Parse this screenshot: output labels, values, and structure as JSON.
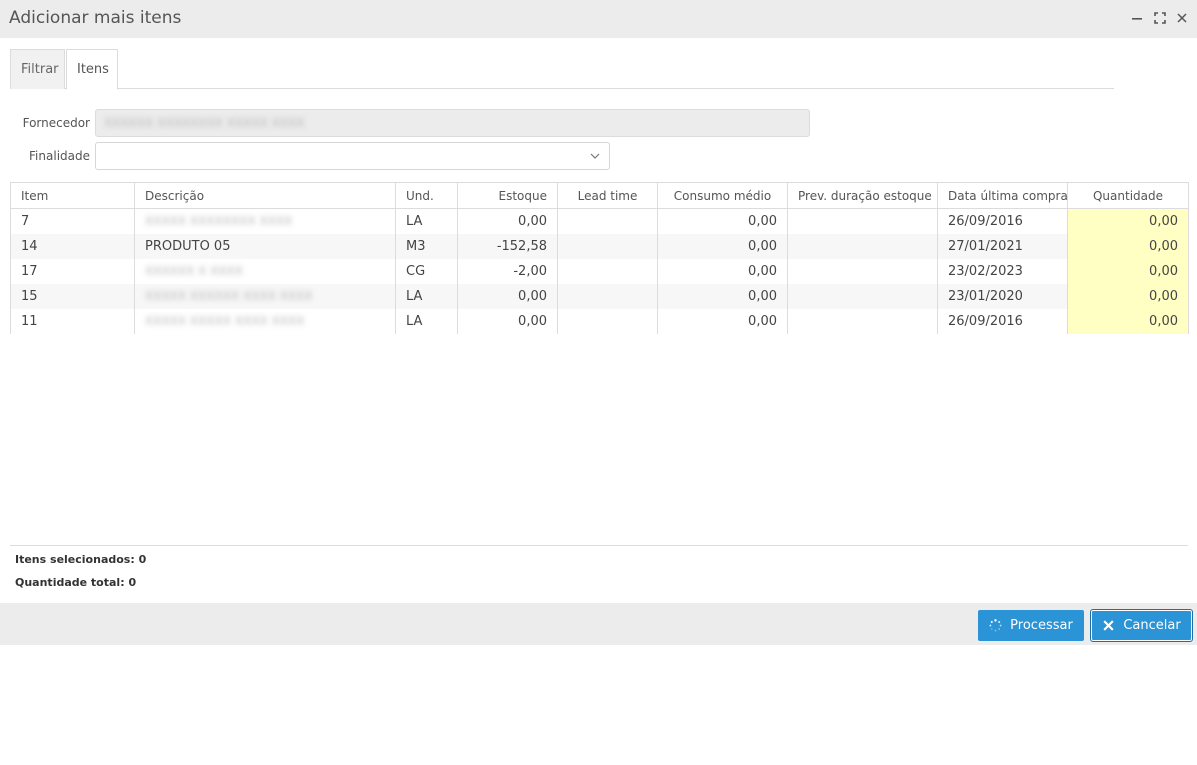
{
  "window": {
    "title": "Adicionar mais itens"
  },
  "tabs": [
    {
      "label": "Filtrar"
    },
    {
      "label": "Itens"
    }
  ],
  "form": {
    "fornecedor_label": "Fornecedor",
    "fornecedor_value": "XXXXXX XXXXXXXX XXXXX XXXX",
    "finalidade_label": "Finalidade",
    "finalidade_value": ""
  },
  "table": {
    "columns": [
      "Item",
      "Descrição",
      "Und.",
      "Estoque",
      "Lead time",
      "Consumo médio",
      "Prev. duração estoque",
      "Data última compra",
      "Quantidade"
    ],
    "rows": [
      {
        "item": "7",
        "descricao": "XXXXX XXXXXXXX XXXX",
        "und": "LA",
        "estoque": "0,00",
        "lead_time": "",
        "consumo": "0,00",
        "prev": "",
        "data": "26/09/2016",
        "quantidade": "0,00",
        "blur": true
      },
      {
        "item": "14",
        "descricao": "PRODUTO 05",
        "und": "M3",
        "estoque": "-152,58",
        "lead_time": "",
        "consumo": "0,00",
        "prev": "",
        "data": "27/01/2021",
        "quantidade": "0,00",
        "blur": false
      },
      {
        "item": "17",
        "descricao": "XXXXXX X XXXX",
        "und": "CG",
        "estoque": "-2,00",
        "lead_time": "",
        "consumo": "0,00",
        "prev": "",
        "data": "23/02/2023",
        "quantidade": "0,00",
        "blur": true
      },
      {
        "item": "15",
        "descricao": "XXXXX XXXXXX XXXX XXXX",
        "und": "LA",
        "estoque": "0,00",
        "lead_time": "",
        "consumo": "0,00",
        "prev": "",
        "data": "23/01/2020",
        "quantidade": "0,00",
        "blur": true
      },
      {
        "item": "11",
        "descricao": "XXXXX XXXXX XXXX XXXX",
        "und": "LA",
        "estoque": "0,00",
        "lead_time": "",
        "consumo": "0,00",
        "prev": "",
        "data": "26/09/2016",
        "quantidade": "0,00",
        "blur": true
      }
    ]
  },
  "summary": {
    "selecionados_label": "Itens selecionados:",
    "selecionados_value": "0",
    "total_label": "Quantidade total:",
    "total_value": "0"
  },
  "actions": {
    "processar_label": "Processar",
    "cancelar_label": "Cancelar"
  },
  "colors": {
    "accent": "#2a94d6",
    "quantity_cell": "#ffffc4",
    "bar_bg": "#ececec"
  },
  "icons": {
    "minimize": "minimize-icon",
    "maximize": "maximize-icon",
    "close": "close-icon",
    "dropdown": "chevron-down-icon",
    "processar": "spinner-icon",
    "cancelar": "x-icon"
  }
}
